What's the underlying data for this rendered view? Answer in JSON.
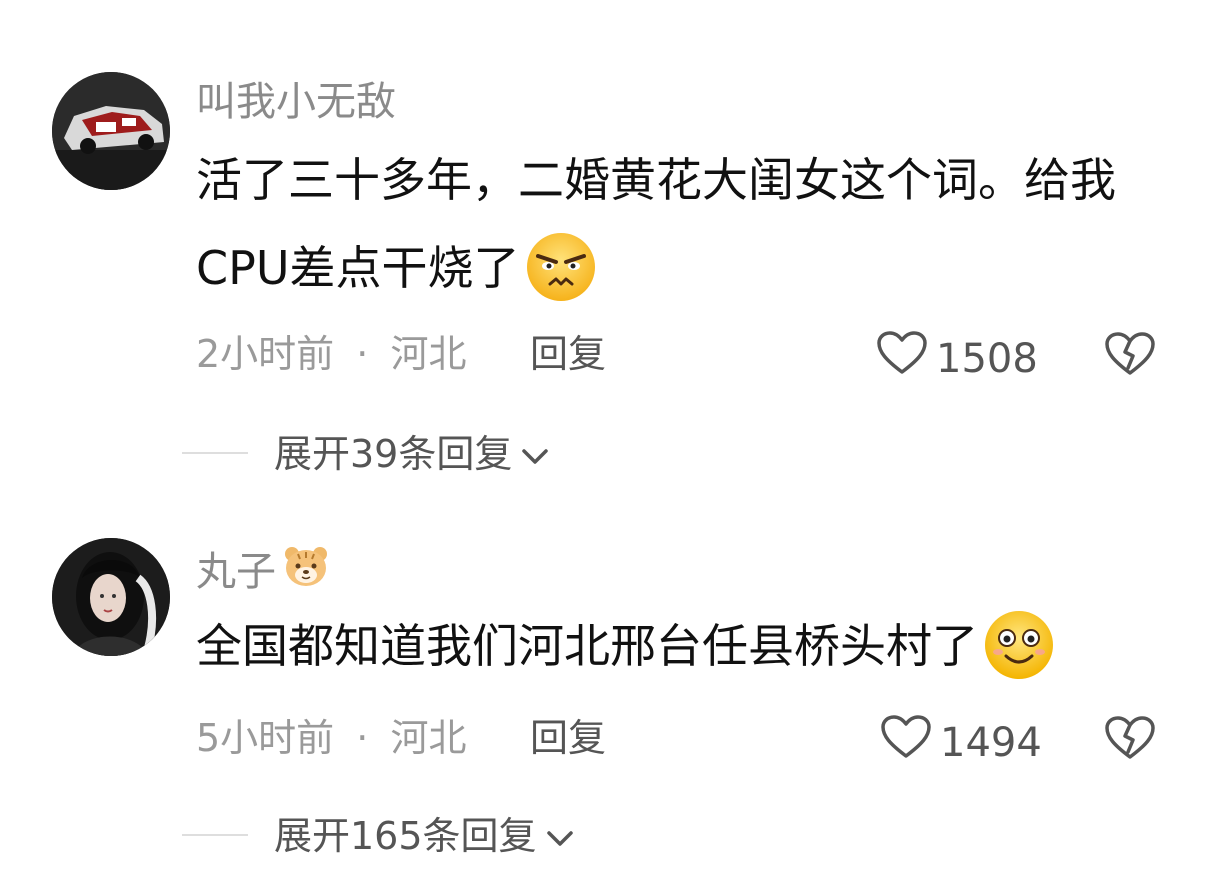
{
  "comments": [
    {
      "username": "叫我小无敌",
      "text": "活了三十多年，二婚黄花大闺女这个词。给我CPU差点干烧了",
      "inline_emoji": "angry-face-emoji",
      "time": "2小时前",
      "separator": "·",
      "location": "河北",
      "reply_label": "回复",
      "likes": "1508",
      "expand_label": "展开39条回复"
    },
    {
      "username": "丸子",
      "username_badge": "tiger-emoji",
      "text": "全国都知道我们河北邢台任县桥头村了",
      "inline_emoji": "smiling-face-emoji",
      "time": "5小时前",
      "separator": "·",
      "location": "河北",
      "reply_label": "回复",
      "likes": "1494",
      "expand_label": "展开165条回复"
    }
  ],
  "colors": {
    "username": "#8a8a8a",
    "text": "#111111",
    "meta": "#9a9a9a",
    "action": "#555555",
    "divider": "#dedede"
  }
}
